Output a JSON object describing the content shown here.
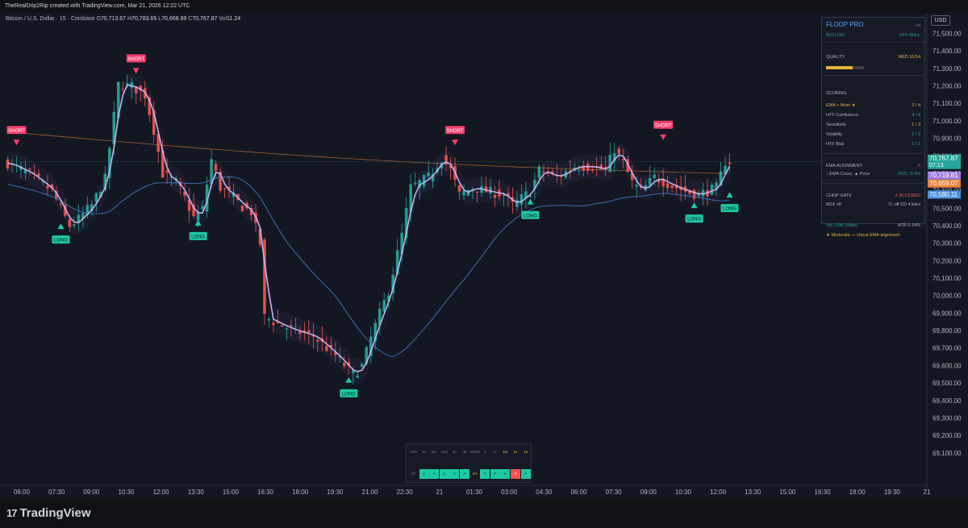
{
  "topbar": {
    "attribution": "TheRealDrip2Rip created with TradingView.com, Mar 21, 2026 12:22 UTC"
  },
  "symbol": {
    "name": "Bitcoin / U.S. Dollar · 15 · Coinbase",
    "open_label": "O",
    "open": "70,713.67",
    "high_label": "H",
    "high": "70,783.65",
    "low_label": "L",
    "low": "70,668.99",
    "close_label": "C",
    "close": "70,767.87",
    "vol_label": "Vol",
    "vol": "11.24"
  },
  "currency": "USD",
  "colors": {
    "bull": "#26a69a",
    "bear": "#ef5350",
    "background": "#131722",
    "ema_fast": "#8e7cc3",
    "ema_slow": "#3a6fb0",
    "ema_orange": "#c4733a",
    "signal_long": "#1dc9a5",
    "signal_short": "#f23f6d"
  },
  "chart_data": {
    "type": "candlestick",
    "x_ticks": [
      "06:00",
      "07:30",
      "09:00",
      "10:30",
      "12:00",
      "13:30",
      "15:00",
      "16:30",
      "18:00",
      "19:30",
      "21:00",
      "22:30",
      "21",
      "01:30",
      "03:00",
      "04:30",
      "06:00",
      "07:30",
      "09:00",
      "10:30",
      "12:00",
      "13:30",
      "15:00",
      "16:30",
      "18:00",
      "19:30",
      "21"
    ],
    "y_ticks": [
      "71,500.00",
      "71,400.00",
      "71,300.00",
      "71,200.00",
      "71,100.00",
      "71,000.00",
      "70,900.00",
      "70,800.00",
      "70,700.00",
      "70,600.00",
      "70,500.00",
      "70,400.00",
      "70,300.00",
      "70,200.00",
      "70,100.00",
      "70,000.00",
      "69,900.00",
      "69,800.00",
      "69,700.00",
      "69,600.00",
      "69,500.00",
      "69,400.00",
      "69,300.00",
      "69,200.00",
      "69,100.00"
    ],
    "ylim": [
      69060,
      71560
    ],
    "path_points": [
      [
        0,
        70760
      ],
      [
        5,
        70700
      ],
      [
        10,
        70600
      ],
      [
        14,
        70400
      ],
      [
        16,
        70440
      ],
      [
        19,
        70520
      ],
      [
        22,
        70670
      ],
      [
        25,
        71210
      ],
      [
        28,
        71200
      ],
      [
        31,
        71150
      ],
      [
        33,
        70950
      ],
      [
        35,
        70700
      ],
      [
        38,
        70650
      ],
      [
        40,
        70560
      ],
      [
        42,
        70450
      ],
      [
        44,
        70500
      ],
      [
        46,
        70780
      ],
      [
        48,
        70620
      ],
      [
        50,
        70590
      ],
      [
        53,
        70510
      ],
      [
        55,
        70480
      ],
      [
        57,
        70300
      ],
      [
        58,
        69880
      ],
      [
        62,
        69830
      ],
      [
        65,
        69800
      ],
      [
        69,
        69770
      ],
      [
        74,
        69660
      ],
      [
        78,
        69550
      ],
      [
        80,
        69600
      ],
      [
        82,
        69760
      ],
      [
        84,
        69900
      ],
      [
        86,
        70030
      ],
      [
        89,
        70350
      ],
      [
        91,
        70620
      ],
      [
        95,
        70680
      ],
      [
        98,
        70790
      ],
      [
        100,
        70720
      ],
      [
        102,
        70580
      ],
      [
        105,
        70620
      ],
      [
        108,
        70600
      ],
      [
        112,
        70580
      ],
      [
        114,
        70520
      ],
      [
        118,
        70600
      ],
      [
        120,
        70720
      ],
      [
        124,
        70680
      ],
      [
        128,
        70740
      ],
      [
        132,
        70740
      ],
      [
        135,
        70720
      ],
      [
        137,
        70840
      ],
      [
        139,
        70760
      ],
      [
        141,
        70650
      ],
      [
        143,
        70600
      ],
      [
        146,
        70680
      ],
      [
        150,
        70630
      ],
      [
        154,
        70590
      ],
      [
        156,
        70580
      ],
      [
        160,
        70620
      ],
      [
        162,
        70767.87
      ]
    ],
    "price_labels": [
      {
        "value": "70,767.87",
        "sub": "07:13",
        "y": 70767.87,
        "color": "#26a69a"
      },
      {
        "value": "70,719.81",
        "y": 70719.81,
        "color": "#9f7be0"
      },
      {
        "value": "70,659.07",
        "y": 70659.07,
        "color": "#e9843c"
      },
      {
        "value": "70,580.11",
        "y": 70580.11,
        "color": "#4a90e2"
      }
    ],
    "signals": [
      {
        "type": "SHORT",
        "index": 2,
        "price": 70830,
        "label": "SHORT"
      },
      {
        "type": "LONG",
        "index": 12,
        "price": 70420,
        "label": "LONG"
      },
      {
        "type": "SHORT",
        "index": 29,
        "price": 71240,
        "label": "SHORT"
      },
      {
        "type": "LONG",
        "index": 43,
        "price": 70440,
        "label": "LONG"
      },
      {
        "type": "LONG",
        "index": 77,
        "price": 69540,
        "label": "LONG"
      },
      {
        "type": "SHORT",
        "index": 101,
        "price": 70830,
        "label": "SHORT"
      },
      {
        "type": "LONG",
        "index": 118,
        "price": 70560,
        "label": "LONG"
      },
      {
        "type": "SHORT",
        "index": 148,
        "price": 70860,
        "label": "SHORT"
      },
      {
        "type": "LONG",
        "index": 155,
        "price": 70540,
        "label": "LONG"
      },
      {
        "type": "LONG",
        "index": 163,
        "price": 70600,
        "label": "LONG"
      }
    ]
  },
  "panel": {
    "title": "FLOOP PRO",
    "version": "v4",
    "bias": "BULLISH",
    "htf_state": "HTF BULL",
    "quality_label": "QUALITY",
    "quality_value": "MED 10/14",
    "quality_fraction": 0.71,
    "scoring_label": "SCORING",
    "scores": [
      {
        "name": "EMA + Mom ★",
        "value": "2 / 4",
        "color": "#e8b23c"
      },
      {
        "name": "HTF Confluence",
        "value": "4 / 4",
        "color": "#26a69a"
      },
      {
        "name": "Sensitivity",
        "value": "1 / 3",
        "color": "#e8b23c"
      },
      {
        "name": "Volatility",
        "value": "2 / 2",
        "color": "#26a69a"
      },
      {
        "name": "HTF Bias",
        "value": "1 / 1",
        "color": "#26a69a"
      }
    ],
    "ema_alignment_label": "EMA ALIGNMENT",
    "ema_alignment_mark": "X",
    "ema_cross_label": "↓ EMA Cross, ▲ Price",
    "ema_cross_value": "ROC: 0.3%",
    "chop_gate_label": "CHOP GATE",
    "chop_gate_value": "X BLOCKED",
    "adx_label": "ADX off",
    "adx_value": "Cr off CD 4 bars",
    "vol_label": "Vol LOW (Slide)",
    "vol_value": "ATR 0.14%",
    "note": "★ Moderate — check EMA alignment"
  },
  "mini_table": {
    "row1": [
      "HTF",
      "1H",
      "5m",
      "15m",
      "1h",
      "4h",
      "SDHS",
      "1'",
      "5'",
      "5m",
      "12",
      "16"
    ],
    "row2": [
      "EF",
      "A",
      "A",
      "A",
      "A",
      "A",
      "4/1",
      "A",
      "A",
      "A",
      "V",
      "A"
    ]
  },
  "footer": {
    "brand": "TradingView"
  }
}
